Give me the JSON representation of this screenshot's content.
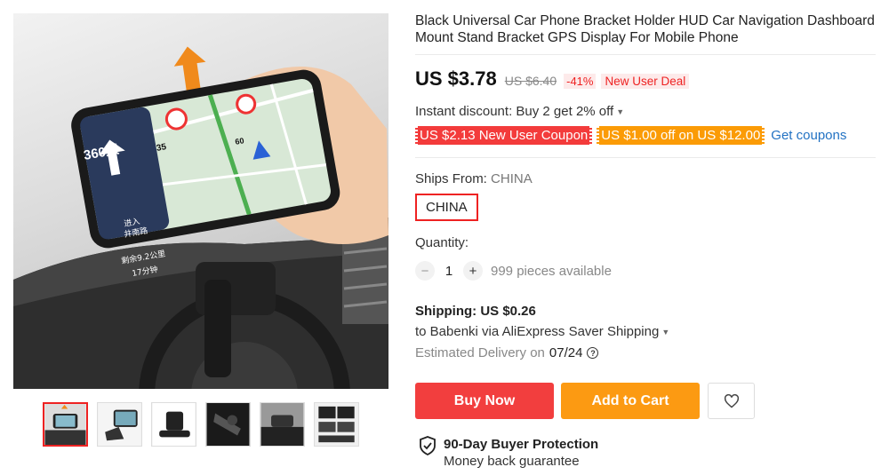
{
  "product": {
    "title": "Black Universal Car Phone Bracket Holder HUD Car Navigation Dashboard Mount Stand Bracket GPS Display For Mobile Phone"
  },
  "image": {
    "distance": "360米",
    "speed_limit": "35",
    "speed_limit_2": "60",
    "enter_label": "进入",
    "road_label": "井南路",
    "remaining": "剩余9.2公里",
    "time": "17分钟"
  },
  "price": {
    "current": "US $3.78",
    "original": "US $6.40",
    "discount": "-41%",
    "deal": "New User Deal"
  },
  "instant_discount": "Instant discount: Buy 2 get 2% off",
  "coupons": {
    "new_user": "US $2.13 New User Coupon",
    "off": "US $1.00 off on US $12.00",
    "get": "Get coupons"
  },
  "ships": {
    "label": "Ships From:",
    "value": "CHINA",
    "option": "CHINA"
  },
  "quantity": {
    "label": "Quantity:",
    "minus": "−",
    "value": "1",
    "plus": "+",
    "available": "999 pieces available"
  },
  "shipping": {
    "cost": "Shipping: US $0.26",
    "via": "to Babenki via AliExpress Saver Shipping",
    "estimated_label": "Estimated Delivery on",
    "estimated_date": "07/24",
    "help": "?"
  },
  "actions": {
    "buy_now": "Buy Now",
    "add_to_cart": "Add to Cart"
  },
  "protection": {
    "title": "90-Day Buyer Protection",
    "subtitle": "Money back guarantee"
  },
  "colors": {
    "accent_red": "#f23e3e",
    "accent_orange": "#fc9a12",
    "link_blue": "#2272c3"
  }
}
